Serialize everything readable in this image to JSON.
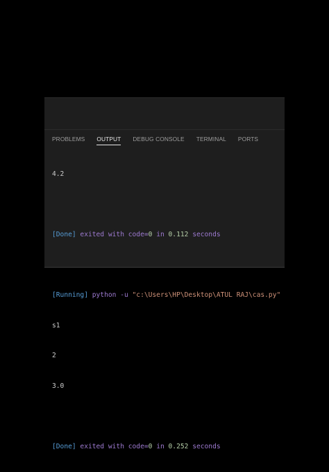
{
  "tabs": [
    {
      "label": "PROBLEMS",
      "active": false
    },
    {
      "label": "OUTPUT",
      "active": true
    },
    {
      "label": "DEBUG CONSOLE",
      "active": false
    },
    {
      "label": "TERMINAL",
      "active": false
    },
    {
      "label": "PORTS",
      "active": false
    }
  ],
  "output": {
    "line1": "4.2",
    "done1": {
      "status": "[Done]",
      "text1": " exited with ",
      "code": "code=",
      "zero": "0",
      "text2": " in ",
      "time": "0.112",
      "unit": " seconds"
    },
    "running": {
      "status": "[Running]",
      "cmd": " python -u ",
      "path": "\"c:\\Users\\HP\\Desktop\\ATUL RAJ\\cas.py\""
    },
    "line_s1": "s1",
    "line_2": "2",
    "line_3": "3.0",
    "done2": {
      "status": "[Done]",
      "text1": " exited with ",
      "code": "code=",
      "zero": "0",
      "text2": " in ",
      "time": "0.252",
      "unit": " seconds"
    }
  }
}
